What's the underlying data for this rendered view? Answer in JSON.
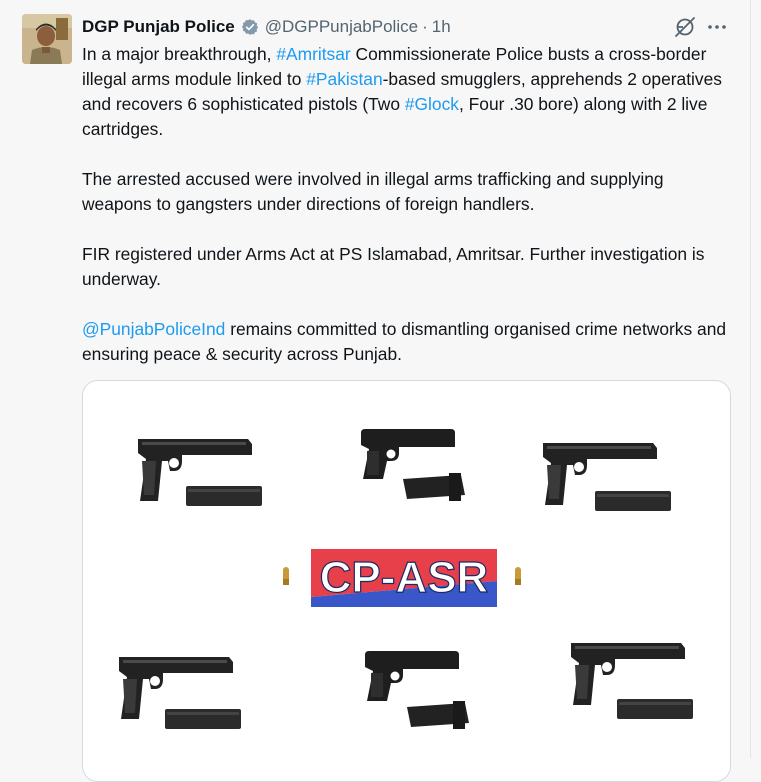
{
  "tweet": {
    "display_name": "DGP Punjab Police",
    "handle": "@DGPPunjabPolice",
    "separator": "·",
    "time": "1h",
    "paragraphs": [
      [
        {
          "text": "In a major breakthrough, "
        },
        {
          "text": "#Amritsar",
          "link": true
        },
        {
          "text": " Commissionerate Police busts a cross-border illegal arms module linked to "
        },
        {
          "text": "#Pakistan",
          "link": true
        },
        {
          "text": "-based smugglers, apprehends 2 operatives and recovers 6 sophisticated pistols (Two "
        },
        {
          "text": "#Glock",
          "link": true
        },
        {
          "text": ", Four .30 bore) along with 2 live cartridges."
        }
      ],
      [
        {
          "text": "The arrested accused were involved in illegal arms trafficking and supplying weapons to gangsters under directions of foreign handlers."
        }
      ],
      [
        {
          "text": "FIR registered under Arms Act at PS Islamabad, Amritsar. Further investigation is underway."
        }
      ],
      [
        {
          "text": "@PunjabPoliceInd",
          "link": true
        },
        {
          "text": " remains committed to dismantling organised crime networks and ensuring peace & security across Punjab."
        }
      ]
    ],
    "media": {
      "banner_text": "CP-ASR",
      "banner_colors": {
        "top": "#e8404a",
        "bottom": "#3a57c9"
      }
    }
  },
  "colors": {
    "link": "#1d9bf0",
    "verified": "#829aab",
    "text": "#0f1419",
    "secondary": "#536471"
  },
  "icons": {
    "verified": "verified-badge-icon",
    "grok": "grok-icon",
    "more": "more-options-icon"
  }
}
